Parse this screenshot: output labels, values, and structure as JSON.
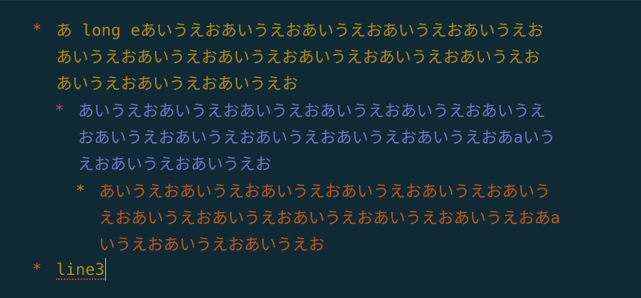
{
  "editor": {
    "bullet_char": "*",
    "items": [
      {
        "level": 1,
        "lines": [
          "あ long eあいうえおあいうえおあいうえおあいうえおあいうえお",
          "あいうえおあいうえおあいうえおあいうえおあいうえおあいうえお",
          "あいうえおあいうえおあいうえお"
        ]
      },
      {
        "level": 2,
        "lines": [
          "あいうえおあいうえおあいうえおあいうえおあいうえおあいうえ",
          "おあいうえおあいうえおあいうえおあいうえおあいうえおあaいう",
          "えおあいうえおあいうえお"
        ]
      },
      {
        "level": 3,
        "lines": [
          "あいうえおあいうえおあいうえおあいうえおあいうえおあいう",
          "えおあいうえおあいうえおあいうえおあいうえおあいうえおあa",
          "いうえおあいうえおあいうえお"
        ]
      },
      {
        "level": 1,
        "lines": [
          "line3"
        ]
      }
    ]
  },
  "colors": {
    "background": "#0f2a35",
    "level1_text": "#b6891c",
    "level2_text": "#6f76c6",
    "level3_text": "#c2561e",
    "spellcheck_underline": "#d04b2a"
  }
}
